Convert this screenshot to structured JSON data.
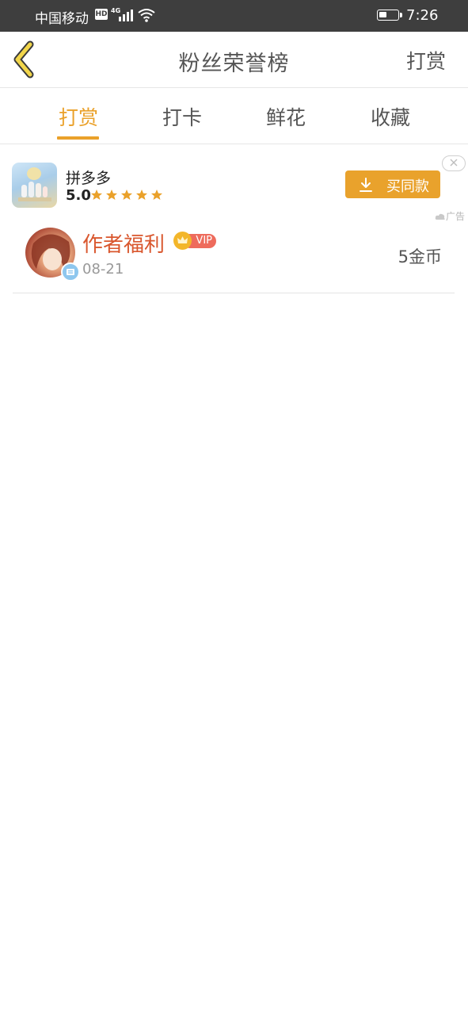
{
  "status_bar": {
    "carrier": "中国移动",
    "hd": "HD",
    "network": "4G",
    "time": "7:26",
    "battery_level": 0.45
  },
  "header": {
    "title": "粉丝荣誉榜",
    "action_label": "打赏"
  },
  "tabs": [
    {
      "label": "打赏",
      "active": true
    },
    {
      "label": "打卡",
      "active": false
    },
    {
      "label": "鲜花",
      "active": false
    },
    {
      "label": "收藏",
      "active": false
    }
  ],
  "ad": {
    "app_name": "拼多多",
    "rating": "5.0",
    "stars": 5,
    "button_label": "买同款",
    "tag": "广告"
  },
  "list": [
    {
      "name": "作者福利",
      "badge": "VIP",
      "date": "08-21",
      "amount": "5金币"
    }
  ],
  "colors": {
    "accent": "#eaa12a",
    "name_red": "#d9572e",
    "vip_red": "#ee6b5c"
  }
}
